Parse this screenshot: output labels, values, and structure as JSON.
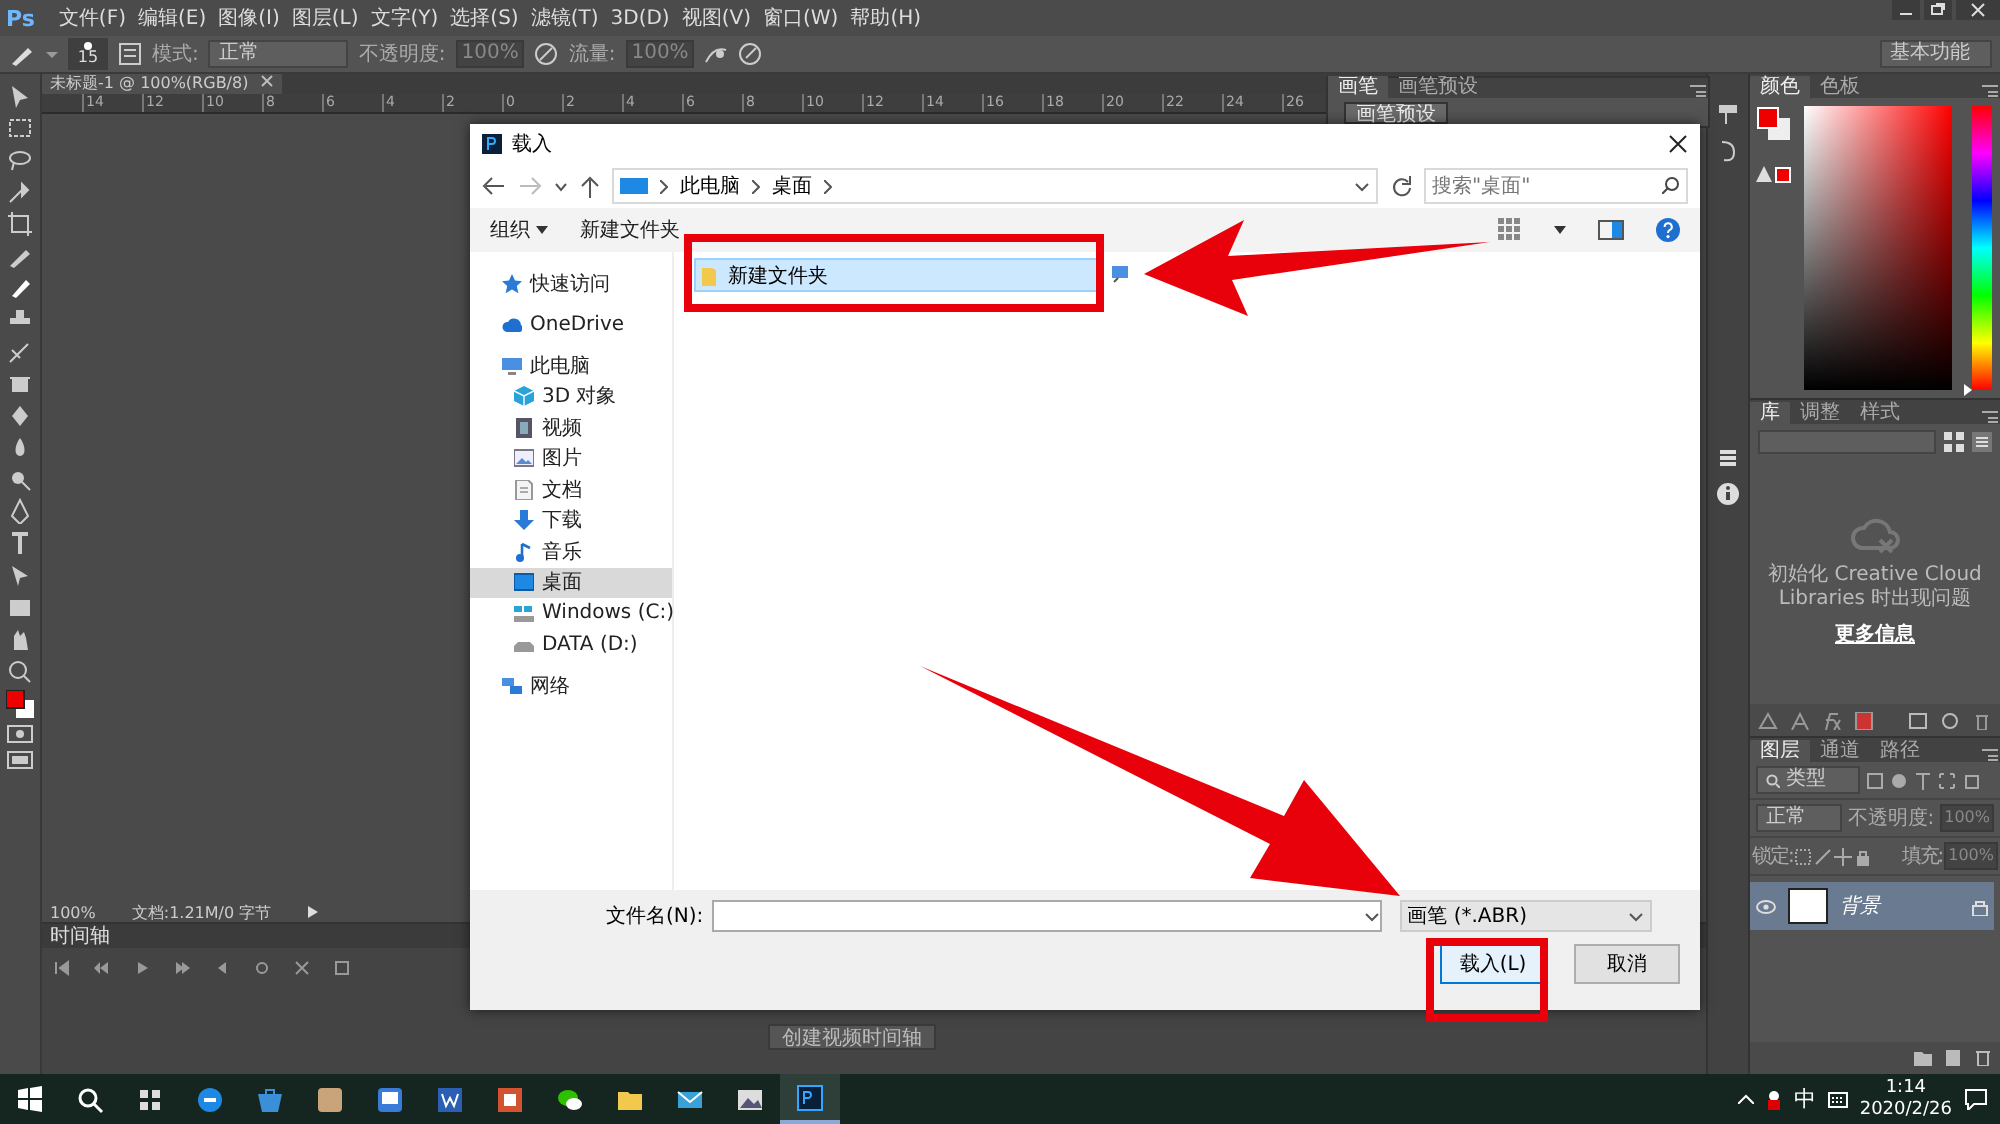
{
  "app": {
    "logo": "Ps",
    "menu": [
      "文件(F)",
      "编辑(E)",
      "图像(I)",
      "图层(L)",
      "文字(Y)",
      "选择(S)",
      "滤镜(T)",
      "3D(D)",
      "视图(V)",
      "窗口(W)",
      "帮助(H)"
    ]
  },
  "options_bar": {
    "brush_size": "15",
    "mode_label": "模式:",
    "mode": "正常",
    "opacity_label": "不透明度:",
    "opacity": "100%",
    "flow_label": "流量:",
    "flow": "100%",
    "workspace": "基本功能"
  },
  "document_tab": {
    "title": "未标题-1 @ 100%(RGB/8)"
  },
  "ruler": [
    "14",
    "12",
    "10",
    "8",
    "6",
    "4",
    "2",
    "0",
    "2",
    "4",
    "6",
    "8",
    "10",
    "12",
    "14",
    "16",
    "18",
    "20",
    "22",
    "24",
    "26"
  ],
  "status_bar": {
    "zoom": "100%",
    "doc_info": "文档:1.21M/0 字节"
  },
  "timeline": {
    "title": "时间轴",
    "create_button": "创建视频时间轴"
  },
  "brush_panel": {
    "tabs": [
      {
        "label": "画笔",
        "selected": true
      },
      {
        "label": "画笔预设",
        "selected": false
      }
    ],
    "preset_button": "画笔预设"
  },
  "color_panel": {
    "tabs": [
      {
        "label": "颜色",
        "selected": true
      },
      {
        "label": "色板",
        "selected": false
      }
    ],
    "hue": {
      "level": 0
    }
  },
  "library_panel": {
    "tabs": [
      {
        "label": "库",
        "selected": true
      },
      {
        "label": "调整",
        "selected": false
      },
      {
        "label": "样式",
        "selected": false
      }
    ],
    "message": "初始化 Creative Cloud Libraries 时出现问题",
    "link": "更多信息"
  },
  "layers_panel": {
    "tabs": [
      {
        "label": "图层",
        "selected": true
      },
      {
        "label": "通道",
        "selected": false
      },
      {
        "label": "路径",
        "selected": false
      }
    ],
    "filter": "类型",
    "blend_mode": "正常",
    "opacity_label": "不透明度:",
    "opacity": "100%",
    "lock_label": "锁定:",
    "fill_label": "填充:",
    "fill": "100%",
    "layers": [
      {
        "name": "背景",
        "visible": true,
        "selected": true,
        "locked": true
      }
    ]
  },
  "dialog": {
    "title": "载入",
    "breadcrumb": [
      "此电脑",
      "桌面"
    ],
    "search_placeholder": "搜索\"桌面\"",
    "organize": "组织",
    "new_folder": "新建文件夹",
    "nav": [
      {
        "label": "快速访问",
        "kind": "star",
        "selected": false
      },
      {
        "label": "OneDrive",
        "kind": "cloud",
        "selected": false
      },
      {
        "label": "此电脑",
        "kind": "computer",
        "selected": false,
        "children": [
          {
            "label": "3D 对象",
            "kind": "cube",
            "selected": false
          },
          {
            "label": "视频",
            "kind": "video",
            "selected": false
          },
          {
            "label": "图片",
            "kind": "picture",
            "selected": false
          },
          {
            "label": "文档",
            "kind": "document",
            "selected": false
          },
          {
            "label": "下载",
            "kind": "download",
            "selected": false
          },
          {
            "label": "音乐",
            "kind": "music",
            "selected": false
          },
          {
            "label": "桌面",
            "kind": "desktop",
            "selected": true
          },
          {
            "label": "Windows (C:)",
            "kind": "system-drive",
            "selected": false
          },
          {
            "label": "DATA (D:)",
            "kind": "drive",
            "selected": false
          }
        ]
      },
      {
        "label": "网络",
        "kind": "network",
        "selected": false
      }
    ],
    "files": [
      {
        "name": "新建文件夹",
        "kind": "folder",
        "selected": true
      },
      {
        "kind": "shortcut",
        "selected": false
      }
    ],
    "filename_label": "文件名(N):",
    "file_type": "画笔 (*.ABR)",
    "buttons": [
      {
        "label": "载入(L)",
        "kind": "primary"
      },
      {
        "label": "取消",
        "kind": "normal"
      }
    ]
  },
  "annotations": [
    {
      "kind": "arrow"
    },
    {
      "kind": "box"
    },
    {
      "kind": "arrow"
    },
    {
      "kind": "box"
    }
  ],
  "taskbar": {
    "apps": [
      {
        "kind": "start",
        "active": false
      },
      {
        "kind": "search",
        "active": false
      },
      {
        "kind": "tiles",
        "active": false
      },
      {
        "kind": "edge",
        "active": false
      },
      {
        "kind": "store",
        "active": false
      },
      {
        "kind": "tan",
        "active": false
      },
      {
        "kind": "blue",
        "active": false
      },
      {
        "kind": "word",
        "active": false
      },
      {
        "kind": "orange",
        "active": false
      },
      {
        "kind": "chat",
        "active": false
      },
      {
        "kind": "folder",
        "active": false
      },
      {
        "kind": "mail",
        "active": false
      },
      {
        "kind": "photos",
        "active": false
      },
      {
        "kind": "ps",
        "active": true
      }
    ],
    "ime": "中",
    "time": "1:14",
    "date": "2020/2/26"
  }
}
